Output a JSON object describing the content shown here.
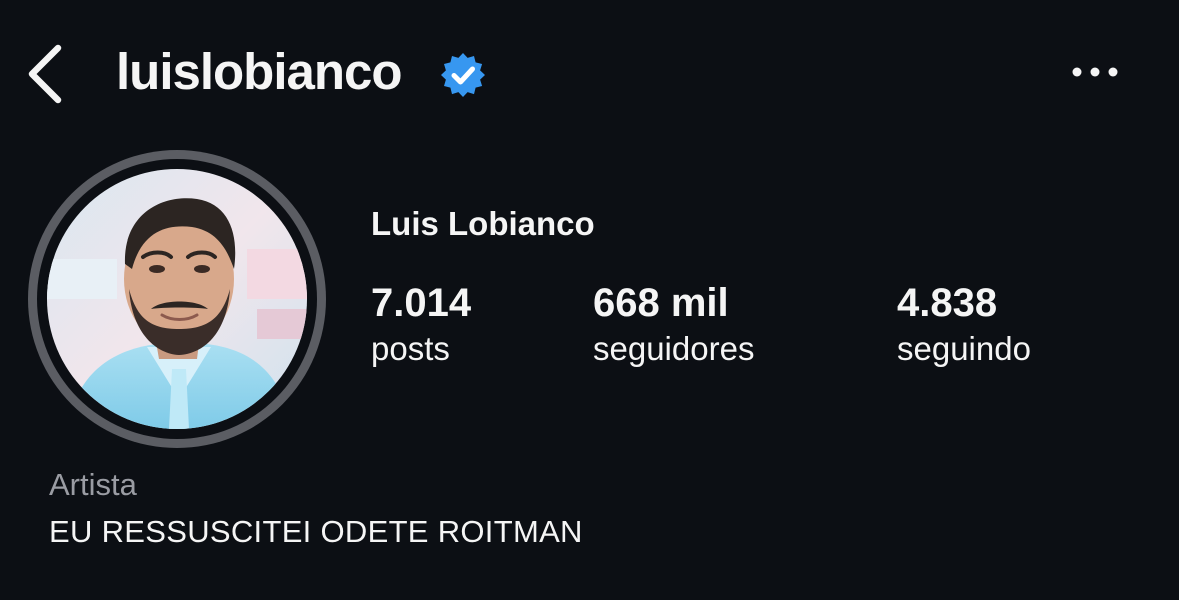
{
  "header": {
    "username": "luislobianco",
    "verified": true,
    "back_icon": "chevron-left-icon",
    "verified_icon": "verified-badge-icon",
    "more_icon": "more-horizontal-icon",
    "verified_color": "#3797f0"
  },
  "profile": {
    "display_name": "Luis Lobianco",
    "stats": [
      {
        "count": "7.014",
        "label": "posts"
      },
      {
        "count": "668 mil",
        "label": "seguidores"
      },
      {
        "count": "4.838",
        "label": "seguindo"
      }
    ],
    "category": "Artista",
    "bio": "EU RESSUSCITEI ODETE ROITMAN"
  },
  "colors": {
    "background": "#0c0f14",
    "text": "#f5f5f5",
    "muted_text": "#9a9ca3",
    "avatar_ring": "#5b5d63"
  }
}
